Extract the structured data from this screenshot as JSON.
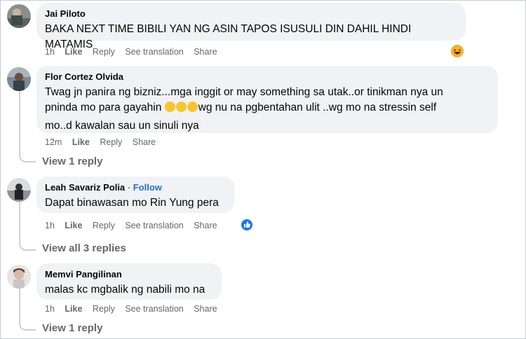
{
  "comments": [
    {
      "author": "Jai Piloto",
      "text": "BAKA NEXT TIME BIBILI YAN NG ASIN TAPOS ISUSULI DIN DAHIL HINDI MATAMIS",
      "time": "1h",
      "like": "Like",
      "reply": "Reply",
      "translate": "See translation",
      "share": "Share",
      "reaction_icon": "laughing-emoji-icon"
    },
    {
      "author": "Flor Cortez Olvida",
      "text_line1": "Twag jn panira ng bizniz...mga inggit or may something sa utak..or tinikman nya un",
      "text_line2_a": "pninda mo para gayahin",
      "text_line2_emojis": "😅😅😅",
      "text_line2_b": "wg nu na pgbentahan ulit ..wg mo na stressin self",
      "text_line3": "mo..d kawalan sau un sinuli nya",
      "time": "12m",
      "like": "Like",
      "reply": "Reply",
      "share": "Share",
      "view_replies": "View 1 reply"
    },
    {
      "author": "Leah Savariz Polia",
      "separator": " · ",
      "follow": "Follow",
      "text": "Dapat binawasan mo Rin Yung pera",
      "time": "1h",
      "like": "Like",
      "reply": "Reply",
      "translate": "See translation",
      "share": "Share",
      "reaction_icon": "like-thumb-icon",
      "view_replies": "View all 3 replies"
    },
    {
      "author": "Memvi Pangilinan",
      "text": "malas kc mgbalik ng nabili mo na",
      "time": "1h",
      "like": "Like",
      "reply": "Reply",
      "translate": "See translation",
      "share": "Share",
      "view_replies": "View 1 reply"
    }
  ],
  "colors": {
    "bubble": "#f0f2f5",
    "meta": "#65676b",
    "follow": "#216fdb",
    "like_badge": "#1877f2"
  }
}
